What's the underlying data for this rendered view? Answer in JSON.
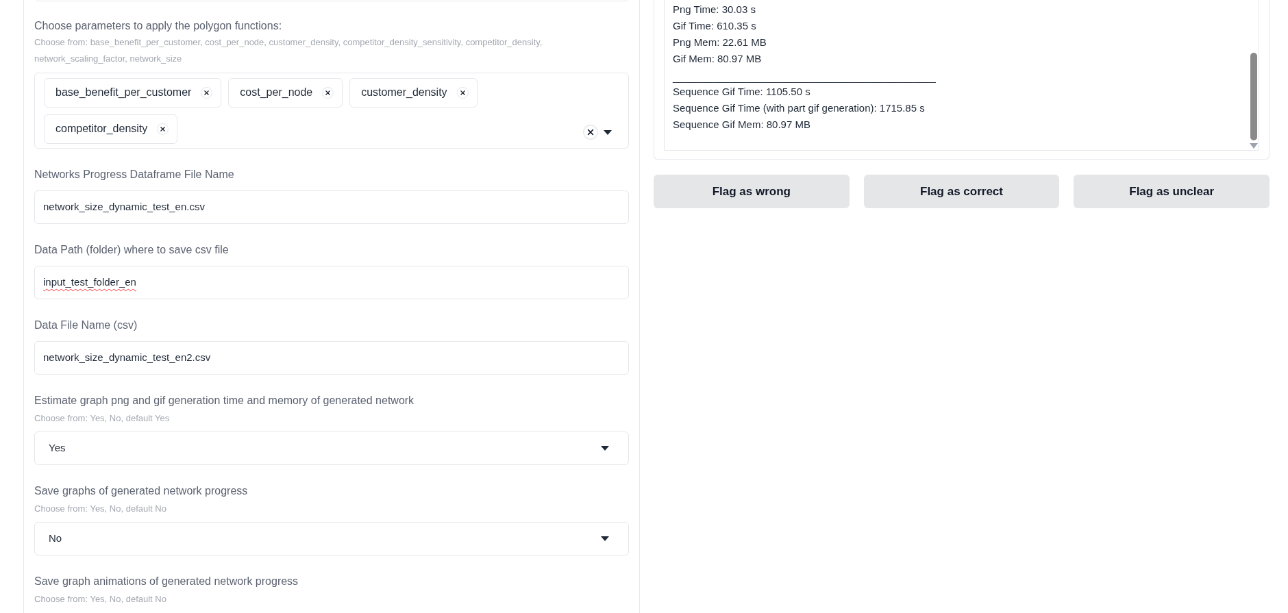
{
  "left_panel": {
    "multiselect": {
      "label": "Choose parameters to apply the polygon functions:",
      "hint": "Choose from: base_benefit_per_customer, cost_per_node, customer_density, competitor_density_sensitivity, competitor_density, network_scaling_factor, network_size",
      "chips": [
        {
          "label": "base_benefit_per_customer"
        },
        {
          "label": "cost_per_node"
        },
        {
          "label": "customer_density"
        },
        {
          "label": "competitor_density"
        }
      ]
    },
    "fields": [
      {
        "kind": "text",
        "label": "Networks Progress Dataframe File Name",
        "value": "network_size_dynamic_test_en.csv",
        "spellcheck_error": false
      },
      {
        "kind": "text",
        "label": "Data Path (folder) where to save csv file",
        "value": "input_test_folder_en",
        "spellcheck_error": true
      },
      {
        "kind": "text",
        "label": "Data File Name (csv)",
        "value": "network_size_dynamic_test_en2.csv",
        "spellcheck_error": false
      },
      {
        "kind": "dropdown",
        "label": "Estimate graph png and gif generation time and memory of generated network",
        "hint": "Choose from: Yes, No, default Yes",
        "value": "Yes"
      },
      {
        "kind": "dropdown",
        "label": "Save graphs of generated network progress",
        "hint": "Choose from: Yes, No, default No",
        "value": "No"
      },
      {
        "kind": "dropdown",
        "label": "Save graph animations of generated network progress",
        "hint": "Choose from: Yes, No, default No"
      }
    ]
  },
  "output": {
    "lines": [
      "Png Time: 30.03 s",
      "Gif Time: 610.35 s",
      "Png Mem: 22.61 MB",
      "Gif Mem: 80.97 MB",
      "______________________________________________",
      "Sequence Gif Time: 1105.50 s",
      "Sequence Gif Time (with part gif generation): 1715.85 s",
      "Sequence Gif Mem: 80.97 MB"
    ]
  },
  "buttons": [
    "Flag as wrong",
    "Flag as correct",
    "Flag as unclear"
  ]
}
